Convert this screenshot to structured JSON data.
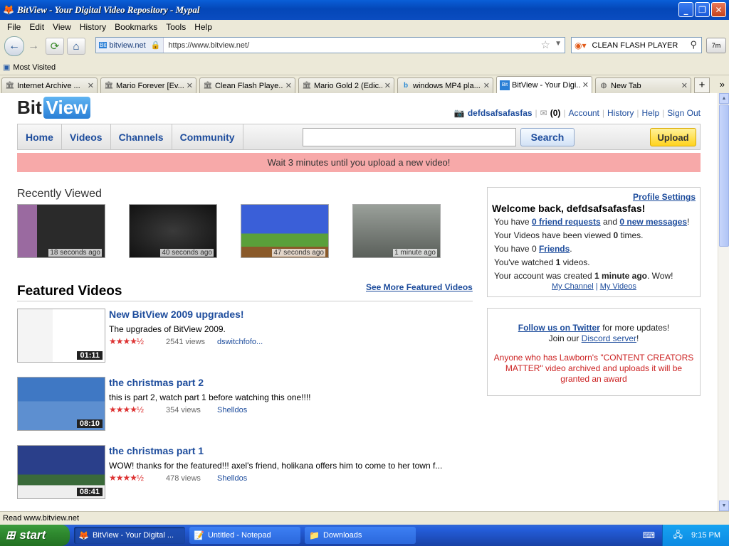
{
  "window": {
    "title": "BitView - Your Digital Video Repository - Mypal",
    "min_label": "_",
    "max_label": "❐",
    "close_label": "✕"
  },
  "menu": [
    "File",
    "Edit",
    "View",
    "History",
    "Bookmarks",
    "Tools",
    "Help"
  ],
  "nav": {
    "site_badge": "bitview.net",
    "url": "https://www.bitview.net/",
    "search_engine_text": "CLEAN FLASH PLAYER",
    "addon_label": "7m"
  },
  "bookmarks": {
    "item": "Most Visited"
  },
  "tabs": [
    {
      "label": "Internet Archive ...",
      "icon": "archive-icon"
    },
    {
      "label": "Mario Forever [Ev...",
      "icon": "archive-icon"
    },
    {
      "label": "Clean Flash Playe...",
      "icon": "archive-icon"
    },
    {
      "label": "Mario Gold 2 (Edic...",
      "icon": "archive-icon"
    },
    {
      "label": "windows MP4 pla...",
      "icon": "bing-icon"
    },
    {
      "label": "BitView - Your Digi...",
      "icon": "bitview-icon"
    },
    {
      "label": "New Tab",
      "icon": "globe-icon"
    }
  ],
  "site": {
    "logo_left": "Bit",
    "logo_right": "View",
    "user": {
      "username": "defdsafsafasfas",
      "inbox_count": "(0)",
      "links": [
        "Account",
        "History",
        "Help",
        "Sign Out"
      ]
    },
    "topnav": [
      "Home",
      "Videos",
      "Channels",
      "Community"
    ],
    "search_button": "Search",
    "upload_button": "Upload",
    "warning": "Wait 3 minutes until you upload a new video!",
    "recent_heading": "Recently Viewed",
    "recent": [
      {
        "ago": "18 seconds ago"
      },
      {
        "ago": "40 seconds ago"
      },
      {
        "ago": "47 seconds ago"
      },
      {
        "ago": "1 minute ago"
      }
    ],
    "featured_heading": "Featured Videos",
    "see_more": "See More Featured Videos",
    "featured": [
      {
        "title": "New BitView 2009 upgrades!",
        "desc": "The upgrades of BitView 2009.",
        "stars": "★★★★½",
        "views": "2541 views",
        "user": "dswitchfofo...",
        "duration": "01:11"
      },
      {
        "title": "the christmas part 2",
        "desc": "this is part 2, watch part 1 before watching this one!!!!",
        "stars": "★★★★½",
        "views": "354 views",
        "user": "Shelldos",
        "duration": "08:10"
      },
      {
        "title": "the christmas part 1",
        "desc": "WOW! thanks for the featured!!! axel's friend, holikana offers him to come to her town f...",
        "stars": "★★★★½",
        "views": "478 views",
        "user": "Shelldos",
        "duration": "08:41"
      }
    ],
    "panel": {
      "profile_settings": "Profile Settings",
      "welcome": "Welcome back, defdsafsafasfas!",
      "friend_requests": "0 friend requests",
      "new_messages": "0 new messages",
      "viewed_prefix": "Your Videos have been viewed ",
      "viewed_count": "0",
      "viewed_suffix": " times.",
      "friends_prefix": "You have 0 ",
      "friends_link": "Friends",
      "watched_prefix": "You've watched ",
      "watched_count": "1",
      "watched_suffix": " videos.",
      "created_prefix": "Your account was created ",
      "created_time": "1 minute ago",
      "created_suffix": ". Wow!",
      "my_channel": "My Channel",
      "my_videos": "My Videos"
    },
    "panel2": {
      "twitter_link": "Follow us on Twitter",
      "twitter_suffix": " for more updates!",
      "discord_prefix": "Join our ",
      "discord_link": "Discord server",
      "discord_suffix": "!",
      "award": "Anyone who has Lawborn's \"CONTENT CREATORS MATTER\" video archived and uploads it will be granted an award"
    }
  },
  "status_text": "Read www.bitview.net",
  "taskbar": {
    "start": "start",
    "items": [
      {
        "label": "BitView - Your Digital ...",
        "icon": "firefox-icon"
      },
      {
        "label": "Untitled - Notepad",
        "icon": "notepad-icon"
      },
      {
        "label": "Downloads",
        "icon": "folder-icon"
      }
    ],
    "clock": "9:15 PM"
  }
}
